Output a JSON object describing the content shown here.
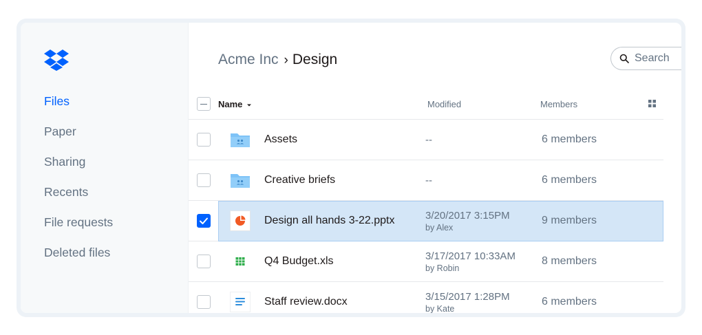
{
  "sidebar": {
    "items": [
      {
        "label": "Files",
        "active": true
      },
      {
        "label": "Paper"
      },
      {
        "label": "Sharing"
      },
      {
        "label": "Recents"
      },
      {
        "label": "File requests"
      },
      {
        "label": "Deleted files"
      }
    ]
  },
  "breadcrumb": {
    "parent": "Acme Inc",
    "separator": "›",
    "current": "Design"
  },
  "search": {
    "placeholder": "Search"
  },
  "table": {
    "columns": {
      "name": "Name",
      "modified": "Modified",
      "members": "Members"
    },
    "rows": [
      {
        "name": "Assets",
        "icon": "shared-folder-icon",
        "modified": "--",
        "by": "",
        "members": "6 members",
        "checked": false
      },
      {
        "name": "Creative briefs",
        "icon": "shared-folder-icon",
        "modified": "--",
        "by": "",
        "members": "6 members",
        "checked": false
      },
      {
        "name": "Design all hands 3-22.pptx",
        "icon": "presentation-icon",
        "modified": "3/20/2017 3:15PM",
        "by": "by Alex",
        "members": "9 members",
        "checked": true
      },
      {
        "name": "Q4 Budget.xls",
        "icon": "spreadsheet-icon",
        "modified": "3/17/2017 10:33AM",
        "by": "by Robin",
        "members": "8 members",
        "checked": false
      },
      {
        "name": "Staff review.docx",
        "icon": "document-icon",
        "modified": "3/15/2017 1:28PM",
        "by": "by Kate",
        "members": "6 members",
        "checked": false
      }
    ]
  },
  "colors": {
    "accent": "#0061fe",
    "selected_row": "#d4e6f7",
    "folder": "#7ec3f7"
  }
}
